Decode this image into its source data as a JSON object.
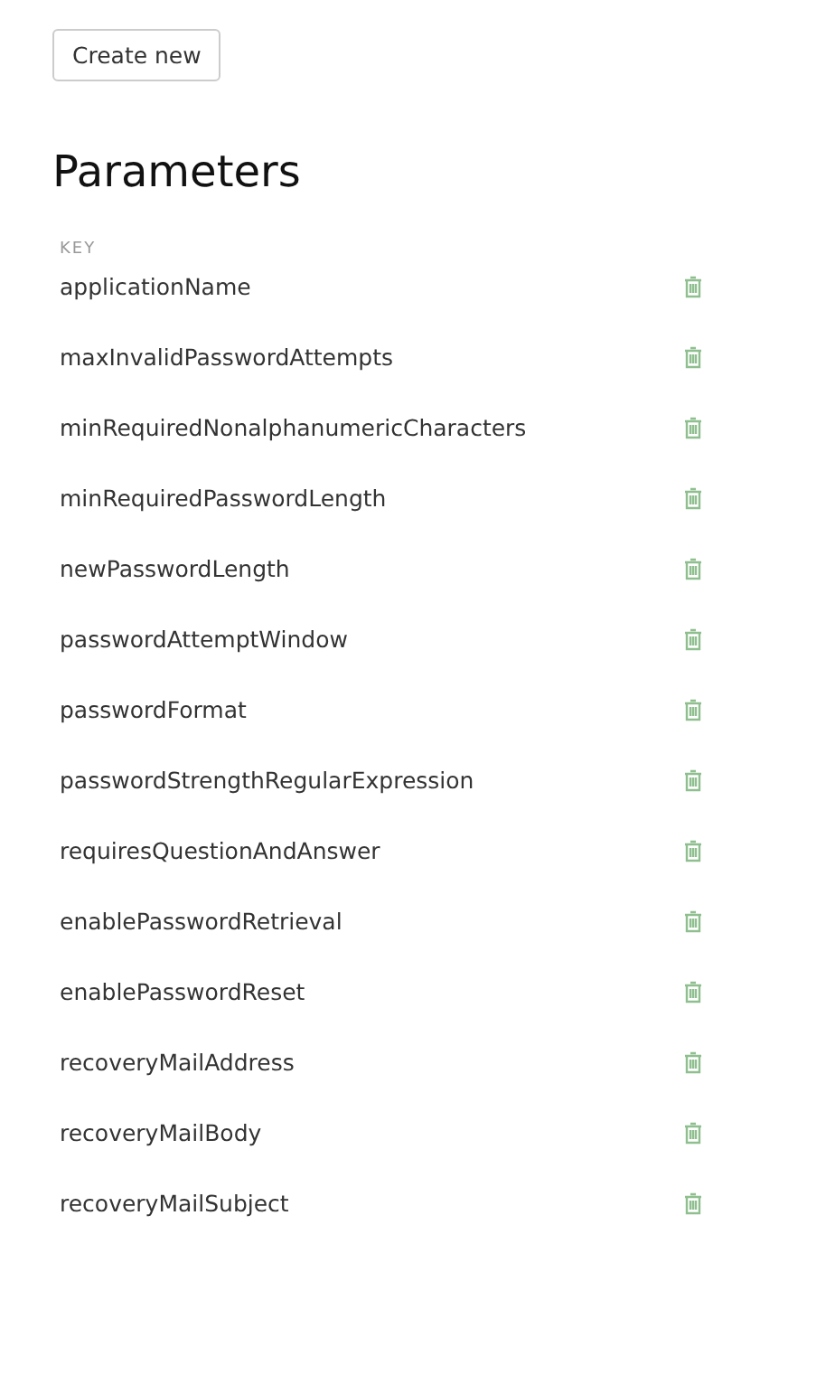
{
  "create_button": "Create new",
  "heading": "Parameters",
  "table": {
    "columns": [
      "KEY"
    ],
    "rows": [
      {
        "key": "applicationName"
      },
      {
        "key": "maxInvalidPasswordAttempts"
      },
      {
        "key": "minRequiredNonalphanumericCharacters"
      },
      {
        "key": "minRequiredPasswordLength"
      },
      {
        "key": "newPasswordLength"
      },
      {
        "key": "passwordAttemptWindow"
      },
      {
        "key": "passwordFormat"
      },
      {
        "key": "passwordStrengthRegularExpression"
      },
      {
        "key": "requiresQuestionAndAnswer"
      },
      {
        "key": "enablePasswordRetrieval"
      },
      {
        "key": "enablePasswordReset"
      },
      {
        "key": "recoveryMailAddress"
      },
      {
        "key": "recoveryMailBody"
      },
      {
        "key": "recoveryMailSubject"
      }
    ]
  }
}
